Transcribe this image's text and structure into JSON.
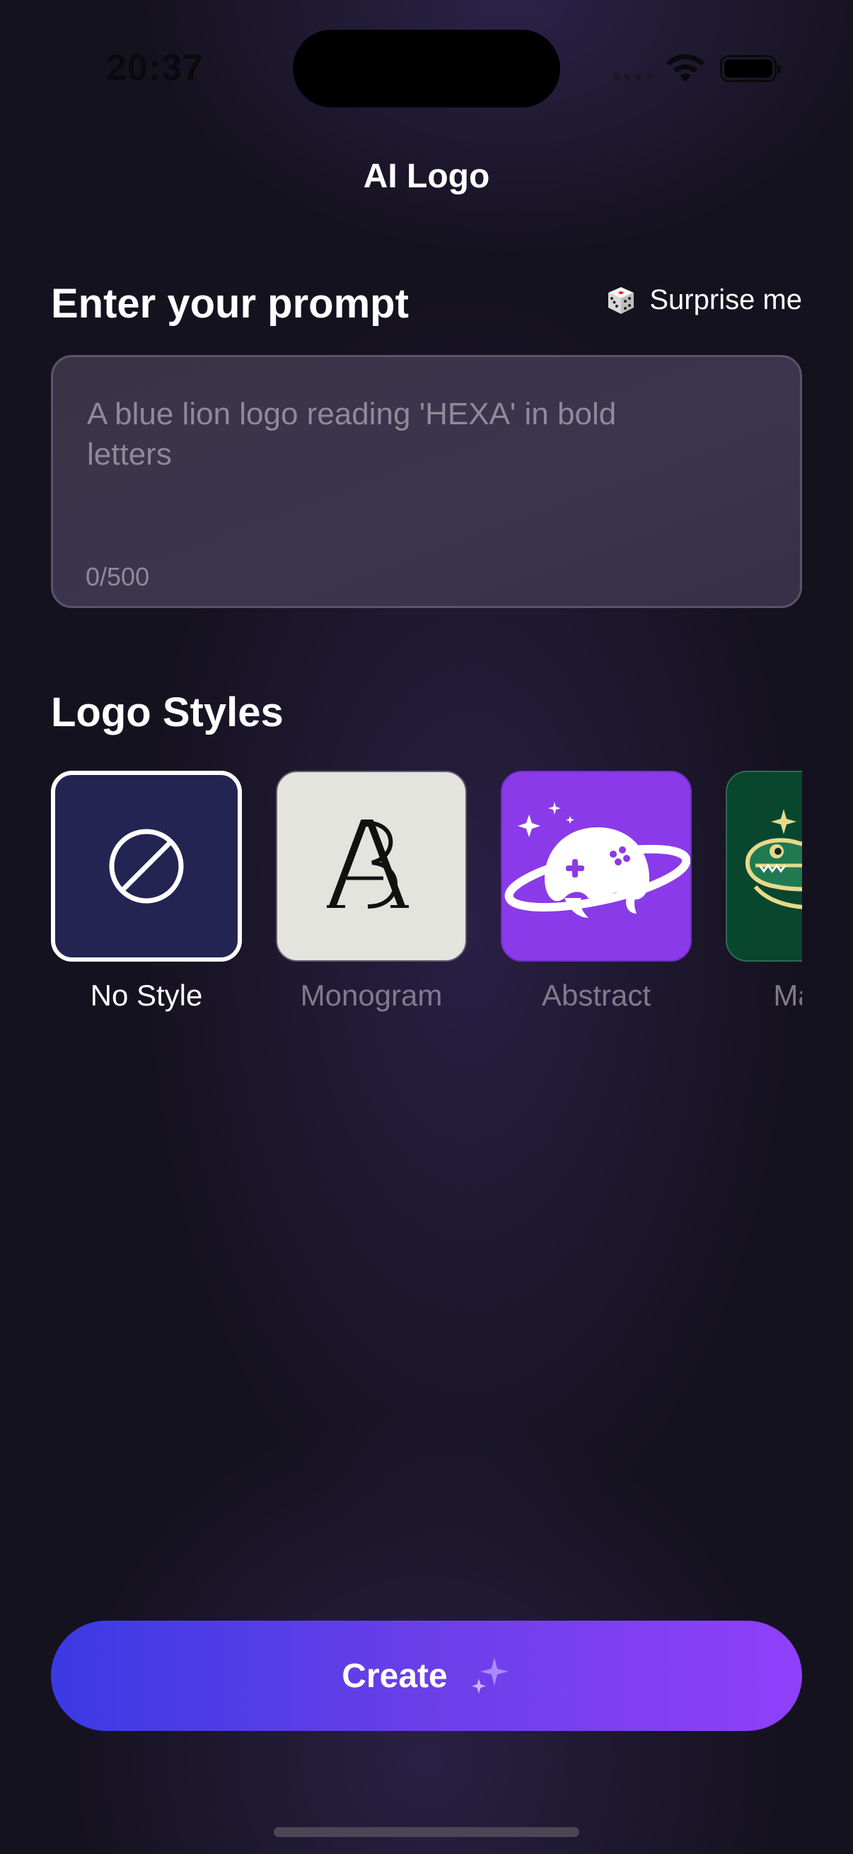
{
  "status_bar": {
    "time": "20:37",
    "icons": [
      "cellular-icon",
      "wifi-icon",
      "battery-icon"
    ]
  },
  "header": {
    "title": "AI Logo"
  },
  "prompt_section": {
    "title": "Enter your prompt",
    "surprise_label": "Surprise me",
    "surprise_icon": "dice-icon",
    "placeholder": "A blue lion logo reading 'HEXA' in bold letters",
    "value": "",
    "counter": "0/500"
  },
  "styles_section": {
    "title": "Logo Styles",
    "selected": "No Style",
    "items": [
      {
        "label": "No Style",
        "icon": "no-style-icon"
      },
      {
        "label": "Monogram",
        "icon": "monogram-image"
      },
      {
        "label": "Abstract",
        "icon": "abstract-image"
      },
      {
        "label": "Mascot",
        "icon": "mascot-image"
      }
    ]
  },
  "create_button": {
    "label": "Create",
    "icon": "sparkle-icon"
  },
  "colors": {
    "background": "#15121f",
    "accent_start": "#3a3ae4",
    "accent_end": "#9040fa",
    "no_style_bg": "#232452",
    "abstract_bg": "#8a3ae8",
    "mascot_bg": "#08462e",
    "monogram_bg": "#e4e4de"
  }
}
